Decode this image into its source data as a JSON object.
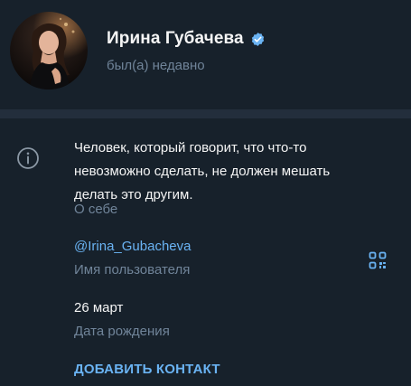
{
  "profile": {
    "name": "Ирина Губачева",
    "status": "был(а) недавно",
    "verified_icon": "verified-badge-icon",
    "avatar": "user-photo"
  },
  "info": {
    "bio": "Человек, который говорит, что что-то невозможно сделать, не должен мешать делать это другим.",
    "bio_caption": "О себе",
    "username": "@Irina_Gubacheva",
    "username_caption": "Имя пользователя",
    "birthday": "26 март",
    "birthday_caption": "Дата рождения",
    "add_contact_label": "ДОБАВИТЬ КОНТАКТ",
    "info_icon": "info-icon",
    "qr_icon": "qr-code-icon"
  },
  "colors": {
    "background": "#17212b",
    "separator": "#232e3c",
    "accent": "#6ab3f3",
    "secondary_text": "#708499"
  }
}
